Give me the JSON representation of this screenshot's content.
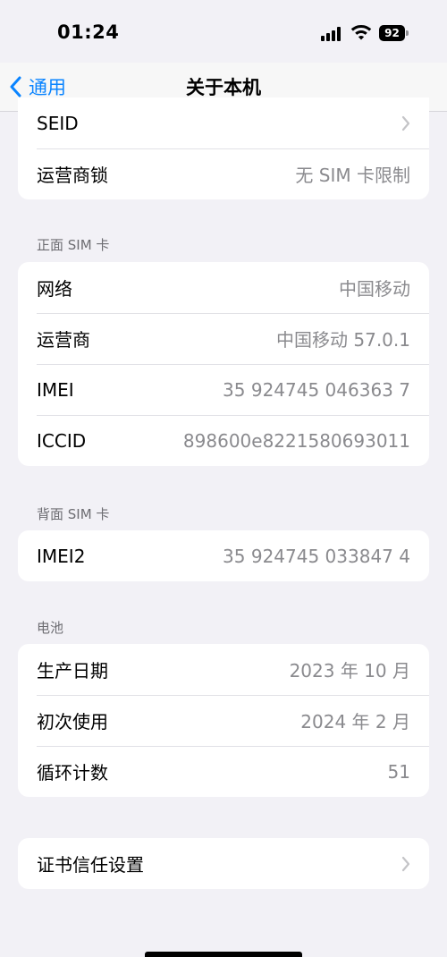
{
  "status": {
    "time": "01:24",
    "battery": "92"
  },
  "nav": {
    "back_label": "通用",
    "title": "关于本机"
  },
  "top_group": {
    "seid_label": "SEID",
    "carrier_lock_label": "运营商锁",
    "carrier_lock_value": "无 SIM 卡限制"
  },
  "front_sim": {
    "header": "正面 SIM 卡",
    "rows": [
      {
        "label": "网络",
        "value": "中国移动"
      },
      {
        "label": "运营商",
        "value": "中国移动 57.0.1"
      },
      {
        "label": "IMEI",
        "value": "35 924745 046363 7"
      },
      {
        "label": "ICCID",
        "value": "898600e8221580693011"
      }
    ]
  },
  "back_sim": {
    "header": "背面 SIM 卡",
    "rows": [
      {
        "label": "IMEI2",
        "value": "35 924745 033847 4"
      }
    ]
  },
  "battery_section": {
    "header": "电池",
    "rows": [
      {
        "label": "生产日期",
        "value": "2023 年 10 月"
      },
      {
        "label": "初次使用",
        "value": "2024 年 2 月"
      },
      {
        "label": "循环计数",
        "value": "51"
      }
    ]
  },
  "certificate": {
    "label": "证书信任设置"
  },
  "icons": {
    "back": "chevron-left-icon",
    "disclosure": "chevron-right-icon",
    "signal": "cellular-signal-icon",
    "wifi": "wifi-icon",
    "battery": "battery-icon"
  },
  "colors": {
    "accent": "#0a84ff",
    "background": "#f2f1f6",
    "secondary_text": "#8a8a8e"
  }
}
